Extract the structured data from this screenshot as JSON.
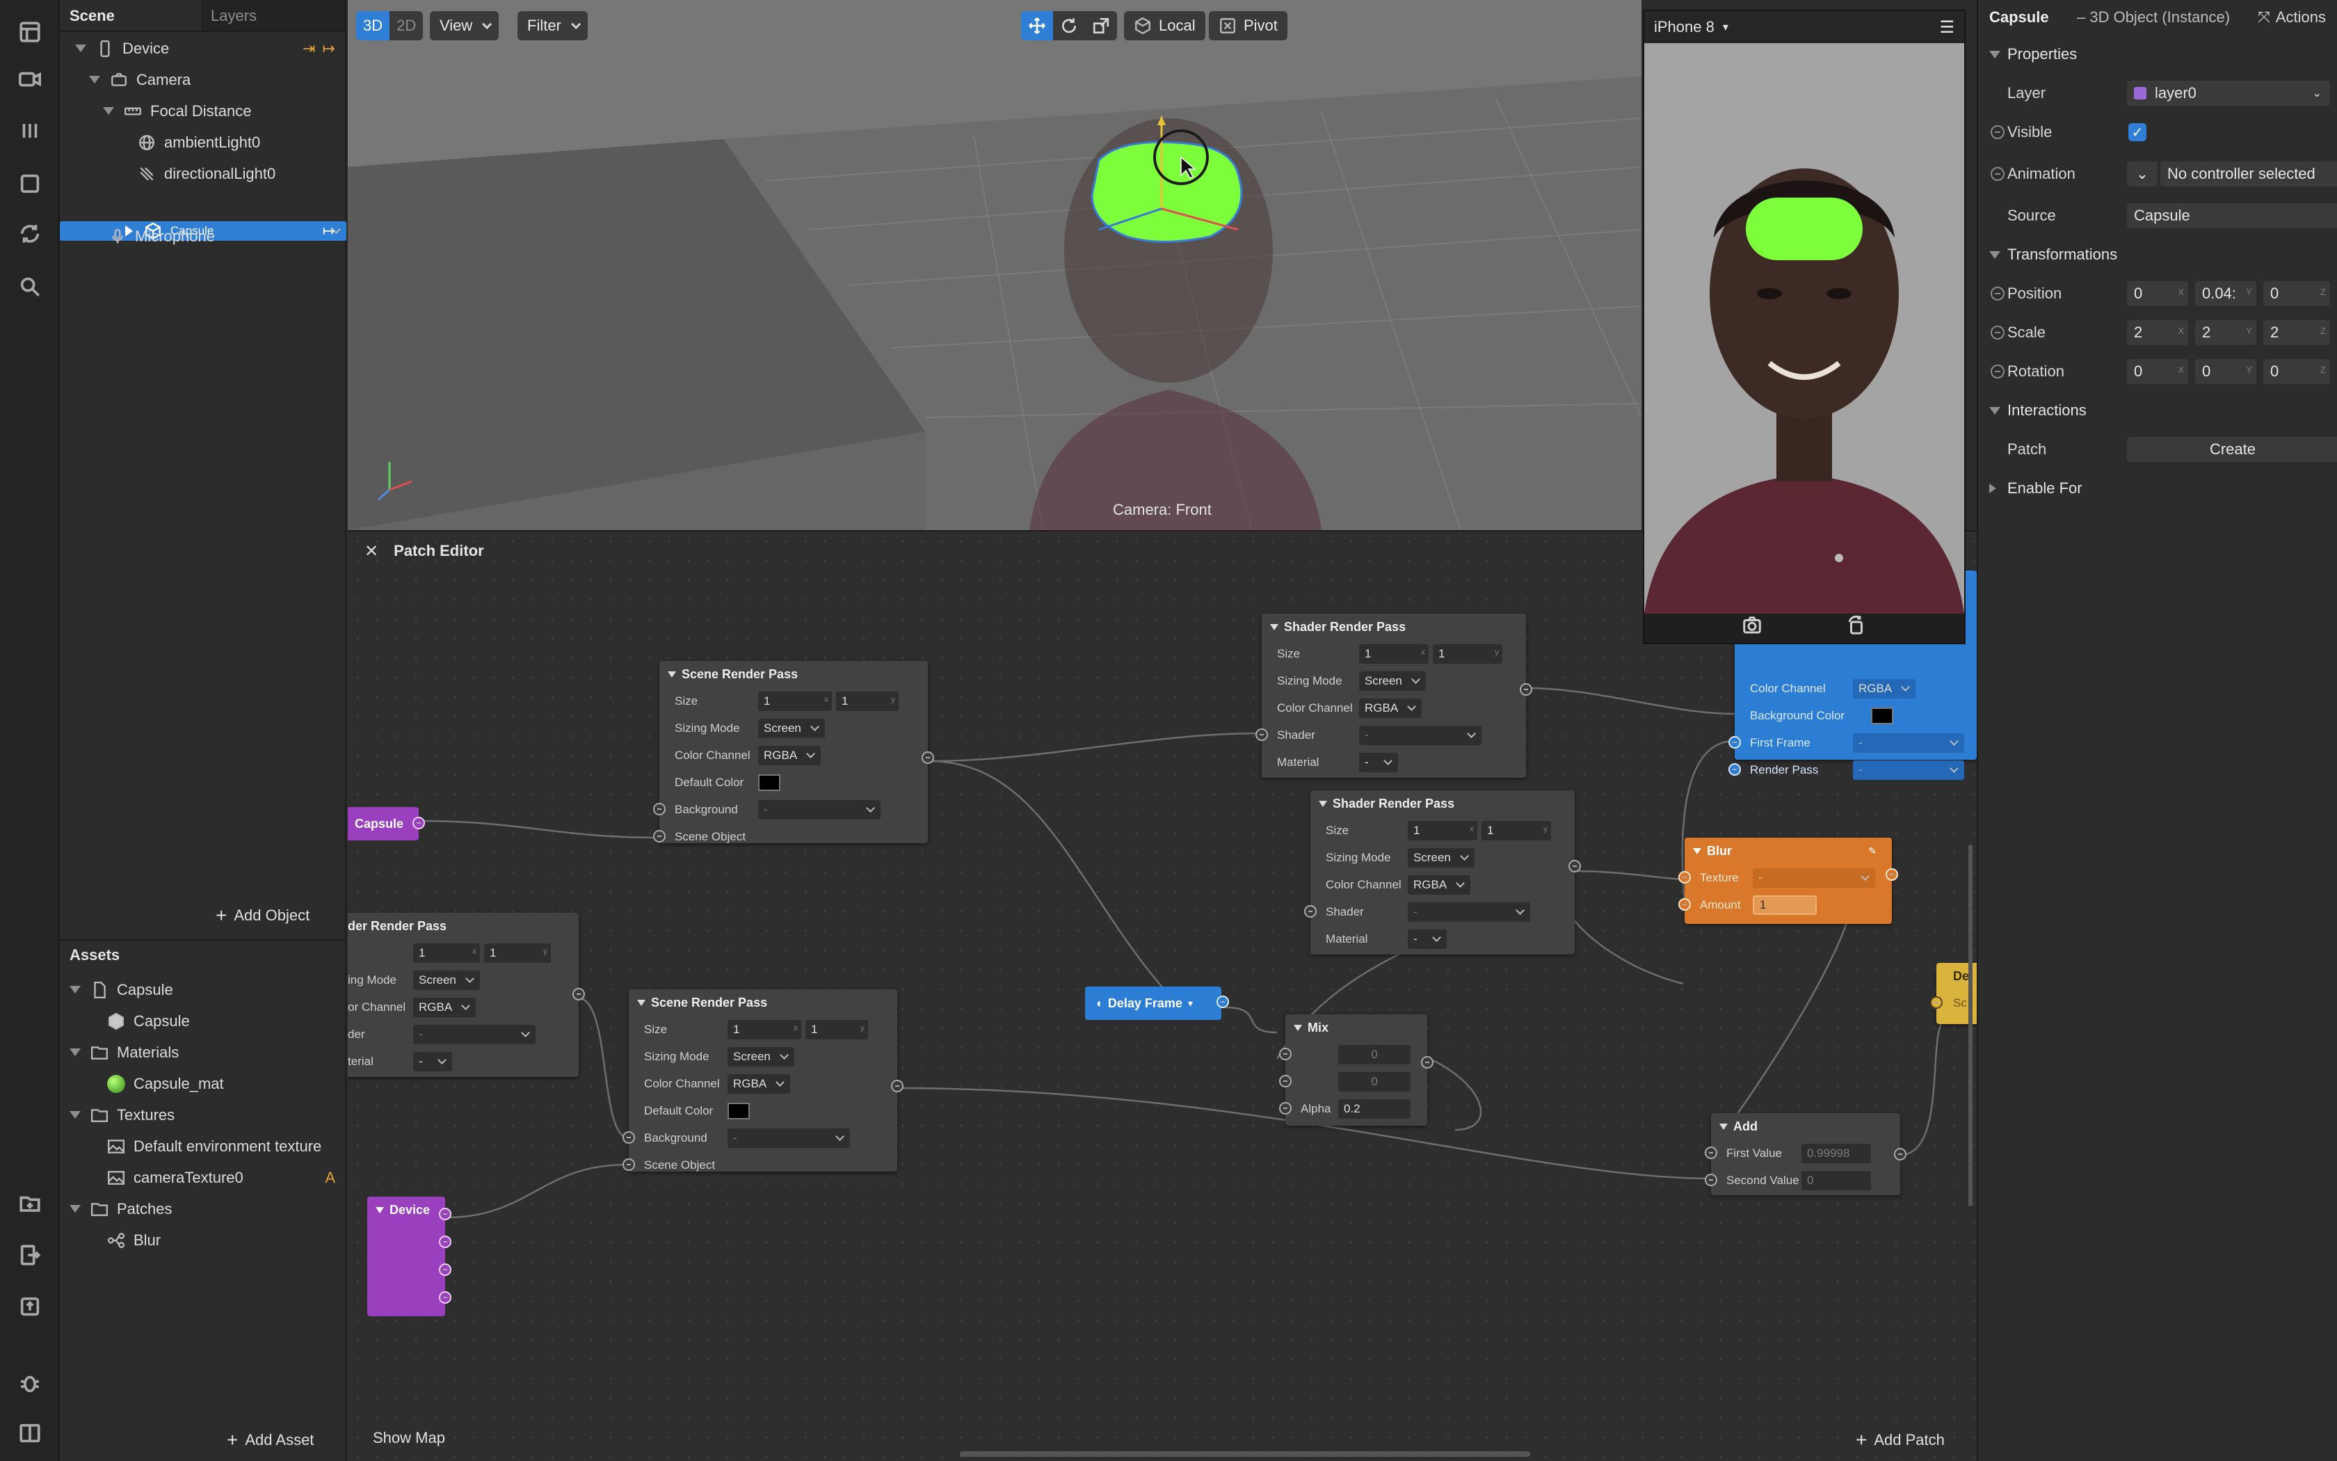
{
  "scene_panel": {
    "tabs": [
      "Scene",
      "Layers"
    ],
    "tree": [
      {
        "label": "Device"
      },
      {
        "label": "Camera"
      },
      {
        "label": "Focal Distance"
      },
      {
        "label": "ambientLight0"
      },
      {
        "label": "directionalLight0"
      },
      {
        "label": "Capsule"
      },
      {
        "label": "Microphone"
      }
    ],
    "add_object": "Add Object"
  },
  "assets_panel": {
    "title": "Assets",
    "tree": [
      {
        "label": "Capsule"
      },
      {
        "label": "Capsule"
      },
      {
        "label": "Materials"
      },
      {
        "label": "Capsule_mat"
      },
      {
        "label": "Textures"
      },
      {
        "label": "Default environment texture"
      },
      {
        "label": "cameraTexture0",
        "badge": "A"
      },
      {
        "label": "Patches"
      },
      {
        "label": "Blur"
      }
    ],
    "add_asset": "Add Asset"
  },
  "viewport": {
    "mode_3d": "3D",
    "mode_2d": "2D",
    "view_label": "View",
    "filter_label": "Filter",
    "local_label": "Local",
    "pivot_label": "Pivot",
    "camera_label": "Camera: Front"
  },
  "phone_preview": {
    "device": "iPhone 8"
  },
  "patch_editor": {
    "title": "Patch Editor",
    "show_map": "Show Map",
    "add_patch": "Add Patch",
    "common": {
      "size": "Size",
      "sizing_mode": "Sizing Mode",
      "color_channel": "Color Channel",
      "default_color": "Default Color",
      "background": "Background",
      "scene_object": "Scene Object",
      "shader": "Shader",
      "material": "Material",
      "screen": "Screen",
      "rgba": "RGBA",
      "one": "1",
      "dash": "-",
      "x": "x",
      "y": "y"
    },
    "nodes": {
      "scene_render_pass_1": "Scene Render Pass",
      "scene_render_pass_2": "Scene Render Pass",
      "shader_render_pass_1": "Shader Render Pass",
      "shader_render_pass_2": "Shader Render Pass",
      "shader_render_pass_3": "der Render Pass",
      "capsule": "Capsule",
      "device": "Device",
      "delay_frame": "Delay Frame",
      "mix": {
        "title": "Mix",
        "in1": "0",
        "in2": "0",
        "alpha_label": "Alpha",
        "alpha": "0.2"
      },
      "blur": {
        "title": "Blur",
        "texture": "Texture",
        "amount_label": "Amount",
        "amount": "1"
      },
      "add": {
        "title": "Add",
        "first_label": "First Value",
        "first": "0.99998",
        "second_label": "Second Value",
        "second": "0"
      },
      "blue_partial": {
        "color_channel": "Color Channel",
        "rgba": "RGBA",
        "background_color": "Background Color",
        "first_frame": "First Frame",
        "render_pass": "Render Pass"
      },
      "yellow_partial": {
        "title": "De",
        "label": "Sc"
      },
      "partial_labels": {
        "sizing": "ing Mode",
        "channel": "or Channel",
        "shader": "der",
        "material": "terial"
      }
    }
  },
  "inspector": {
    "object_name": "Capsule",
    "object_type": "– 3D Object (Instance)",
    "actions": "Actions",
    "properties_title": "Properties",
    "layer_label": "Layer",
    "layer_value": "layer0",
    "layer_color": "#9b6ad6",
    "visible_label": "Visible",
    "animation_label": "Animation",
    "animation_value": "No controller selected",
    "source_label": "Source",
    "source_value": "Capsule",
    "transformations_title": "Transformations",
    "position_label": "Position",
    "position": [
      "0",
      "0.04:",
      "0"
    ],
    "scale_label": "Scale",
    "scale": [
      "2",
      "2",
      "2"
    ],
    "rotation_label": "Rotation",
    "rotation": [
      "0",
      "0",
      "0"
    ],
    "axes": [
      "X",
      "Y",
      "Z"
    ],
    "interactions_title": "Interactions",
    "patch_label": "Patch",
    "patch_button": "Create",
    "enable_for_title": "Enable For"
  },
  "colors": {
    "accent": "#2f7fd6",
    "capsule_green": "#7cff3a",
    "patch_purple": "#9a3fbd",
    "blur_orange": "#d9772a",
    "badge_orange": "#e3a33a"
  },
  "icons": [
    "layout-icon",
    "video-icon",
    "columns-icon",
    "square-icon",
    "refresh-icon",
    "search-icon",
    "import-icon",
    "export-icon",
    "upload-icon",
    "bug-icon",
    "panel-icon"
  ]
}
